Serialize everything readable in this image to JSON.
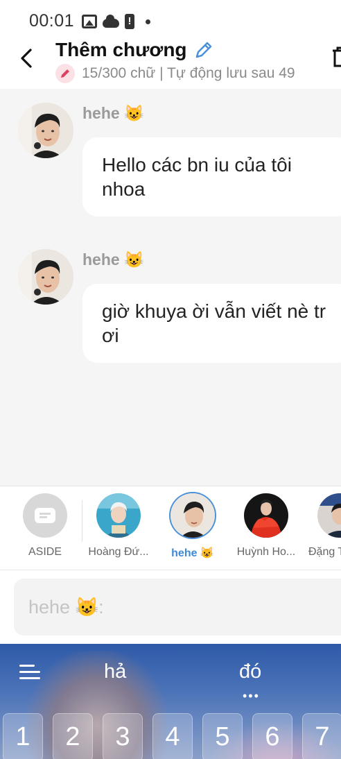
{
  "status_bar": {
    "time": "00:01",
    "icons": [
      "image-icon",
      "cloud-icon",
      "battery-alert-icon",
      "dot-icon"
    ],
    "battery_symbol": "!"
  },
  "header": {
    "title": "Thêm chương",
    "subtitle": "15/300 chữ | Tự động lưu sau 49"
  },
  "messages": [
    {
      "sender": "hehe 😺",
      "text": "Hello các bn iu của tôi nhoa"
    },
    {
      "sender": "hehe 😺",
      "text": "giờ khuya ời vẫn viết nè tr ơi"
    }
  ],
  "characters": [
    {
      "label": "ASIDE",
      "selected": false
    },
    {
      "label": "Hoàng Đứ...",
      "selected": false
    },
    {
      "label": "hehe 😺",
      "selected": true
    },
    {
      "label": "Huỳnh Ho...",
      "selected": false
    },
    {
      "label": "Đặng T",
      "selected": false
    }
  ],
  "input": {
    "placeholder": "hehe 😺:"
  },
  "keyboard": {
    "suggestions": [
      "hả",
      "đó"
    ],
    "number_keys": [
      "1",
      "2",
      "3",
      "4",
      "5",
      "6",
      "7"
    ]
  },
  "colors": {
    "accent": "#4a90d9",
    "edit_pencil": "#e0405f",
    "chat_background": "#f5f5f5"
  }
}
